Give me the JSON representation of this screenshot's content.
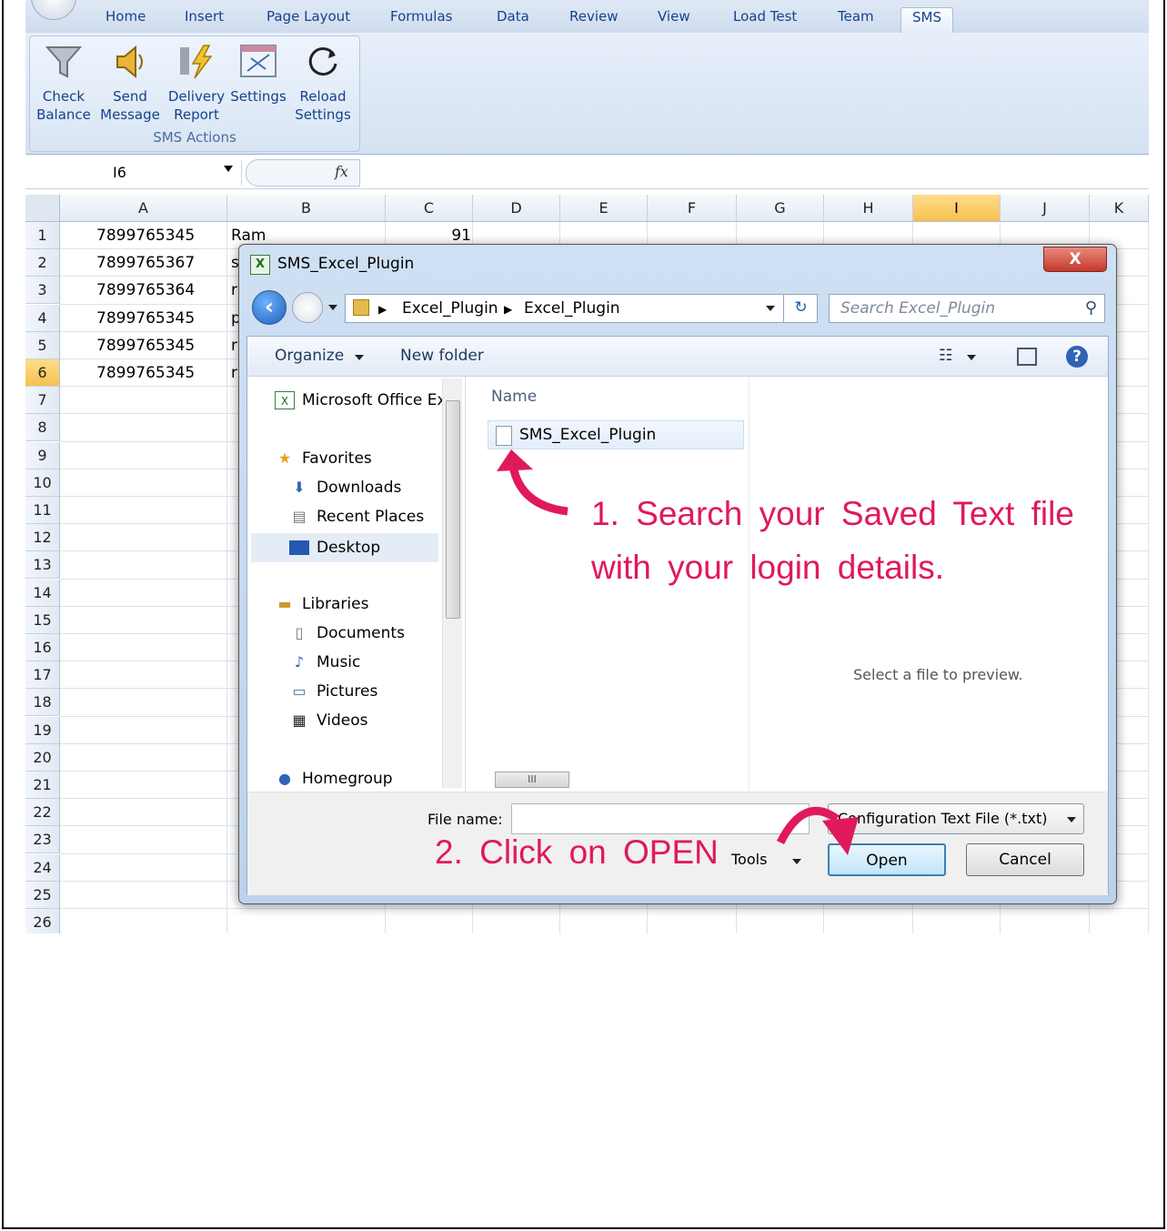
{
  "ribbon": {
    "tabs": [
      "Home",
      "Insert",
      "Page Layout",
      "Formulas",
      "Data",
      "Review",
      "View",
      "Load Test",
      "Team",
      "SMS"
    ],
    "active_tab": "SMS",
    "buttons": [
      {
        "line1": "Check",
        "line2": "Balance",
        "icon": "funnel-icon"
      },
      {
        "line1": "Send",
        "line2": "Message",
        "icon": "speaker-icon"
      },
      {
        "line1": "Delivery",
        "line2": "Report",
        "icon": "lightning-icon"
      },
      {
        "line1": "Settings",
        "line2": "",
        "icon": "settings-window-icon"
      },
      {
        "line1": "Reload",
        "line2": "Settings",
        "icon": "reload-icon"
      }
    ],
    "group_label": "SMS Actions"
  },
  "formula_bar": {
    "name_box": "I6",
    "fx": "fx",
    "formula": ""
  },
  "grid": {
    "columns": [
      "A",
      "B",
      "C",
      "D",
      "E",
      "F",
      "G",
      "H",
      "I",
      "J",
      "K"
    ],
    "selected_column": "I",
    "selected_row": 6,
    "row_count": 26,
    "cells": [
      {
        "a": "7899765345",
        "b": "Ram",
        "c": "91"
      },
      {
        "a": "7899765367",
        "b": "s",
        "c": ""
      },
      {
        "a": "7899765364",
        "b": "r",
        "c": ""
      },
      {
        "a": "7899765345",
        "b": "p",
        "c": ""
      },
      {
        "a": "7899765345",
        "b": "r",
        "c": ""
      },
      {
        "a": "7899765345",
        "b": "r",
        "c": ""
      }
    ]
  },
  "dialog": {
    "title": "SMS_Excel_Plugin",
    "close": "X",
    "breadcrumb": [
      "Excel_Plugin",
      "Excel_Plugin"
    ],
    "search_placeholder": "Search Excel_Plugin",
    "toolbar": {
      "organize": "Organize",
      "new_folder": "New folder"
    },
    "nav": {
      "top_item": "Microsoft Office Ex",
      "favorites": "Favorites",
      "favorites_items": [
        "Downloads",
        "Recent Places",
        "Desktop"
      ],
      "selected": "Desktop",
      "libraries": "Libraries",
      "library_items": [
        "Documents",
        "Music",
        "Pictures",
        "Videos"
      ],
      "homegroup": "Homegroup"
    },
    "column_header": "Name",
    "file": "SMS_Excel_Plugin",
    "preview_text": "Select a file to preview.",
    "file_name_label": "File name:",
    "file_name_value": "",
    "file_type": "Configuration Text File (*.txt)",
    "tools": "Tools",
    "open": "Open",
    "cancel": "Cancel"
  },
  "annotations": {
    "step1_line1": "1. Search your Saved Text file",
    "step1_line2": "with your login details.",
    "step2": "2. Click on OPEN",
    "color": "#e0195b"
  }
}
